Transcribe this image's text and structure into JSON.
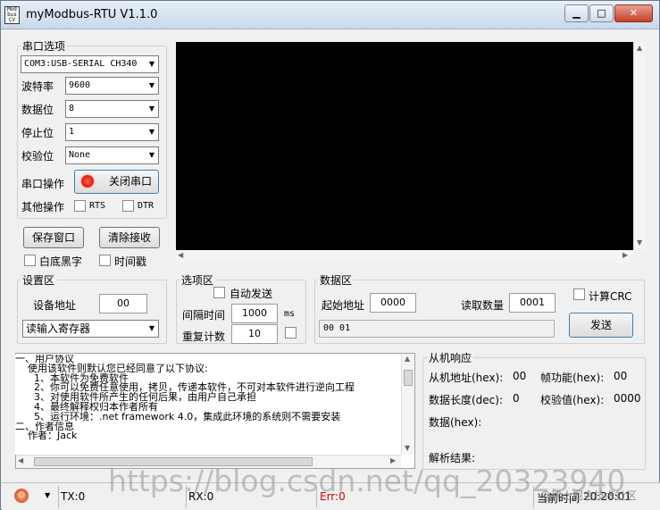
{
  "window": {
    "title": "myModbus-RTU V1.1.0",
    "icon_text": "Mod\nbus\nCV"
  },
  "serial": {
    "group": "串口选项",
    "port": "COM3:USB-SERIAL CH340",
    "baud_label": "波特率",
    "baud": "9600",
    "data_label": "数据位",
    "data": "8",
    "stop_label": "停止位",
    "stop": "1",
    "parity_label": "校验位",
    "parity": "None",
    "op_label": "串口操作",
    "op_button": "关闭串口",
    "other_label": "其他操作",
    "rts": "RTS",
    "dtr": "DTR",
    "save_button": "保存窗口",
    "clear_button": "清除接收",
    "white_black": "白底黑字",
    "timestamp": "时间戳"
  },
  "settings": {
    "group": "设置区",
    "addr_label": "设备地址",
    "addr": "00",
    "func": "读输入寄存器"
  },
  "options": {
    "group": "选项区",
    "auto_send": "自动发送",
    "interval_label": "间隔时间",
    "interval": "1000",
    "interval_unit": "ms",
    "repeat_label": "重复计数",
    "repeat": "10"
  },
  "dataarea": {
    "group": "数据区",
    "start_label": "起始地址",
    "start": "0000",
    "count_label": "读取数量",
    "count": "0001",
    "crc_label": "计算CRC",
    "hex": "00 01",
    "send_button": "发送"
  },
  "terms_lines": [
    "一、用户协议",
    "    使用该软件则默认您已经同意了以下协议:",
    "      1、本软件为免费软件",
    "      2、你可以免费任意使用，拷贝，传递本软件，不可对本软件进行逆向工程",
    "      3、对使用软件所产生的任何后果，由用户自己承担",
    "      4、最终解释权归本作者所有",
    "      5、运行环境：.net framework 4.0，集成此环境的系统则不需要安装",
    "二、作者信息",
    "    作者：Jack"
  ],
  "slave": {
    "group": "从机响应",
    "addr_label": "从机地址(hex):",
    "addr": "00",
    "func_label": "帧功能(hex):",
    "func": "00",
    "len_label": "数据长度(dec):",
    "len": "0",
    "chk_label": "校验值(hex):",
    "chk": "0000",
    "data_label": "数据(hex):",
    "parse_label": "解析结果:"
  },
  "status": {
    "tx": "TX:0",
    "rx": "RX:0",
    "err": "Err:0",
    "time_label": "当前时间",
    "time": "20:20:01"
  },
  "watermark": "https://blog.csdn.net/qq_20323940",
  "watermark2": "@稀土掘金技术社区"
}
